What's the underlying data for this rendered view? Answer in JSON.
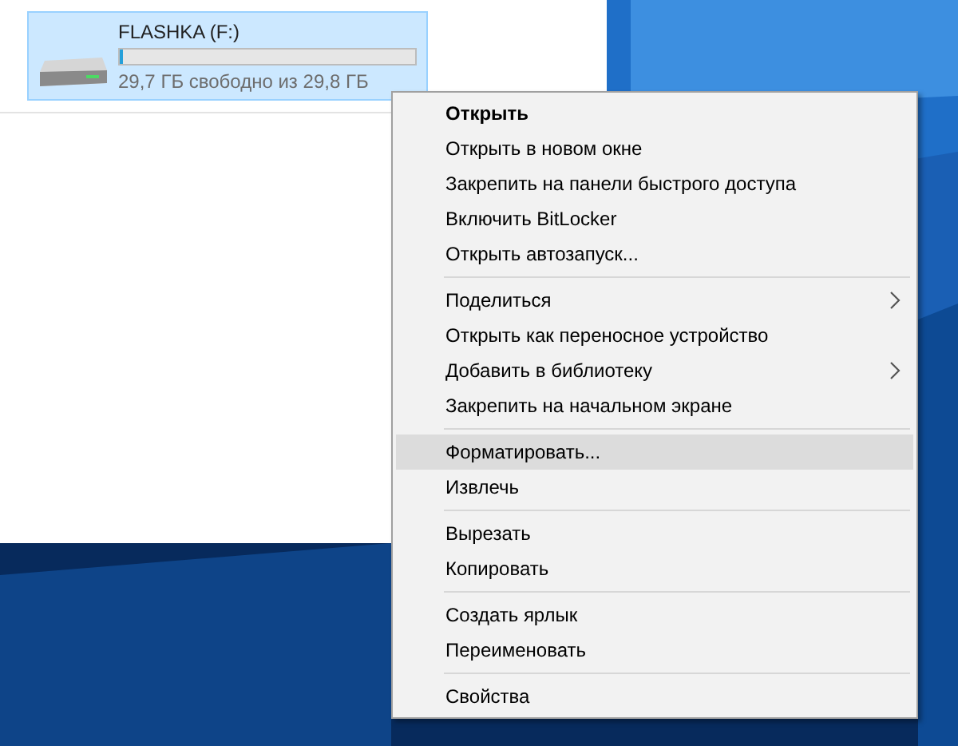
{
  "drive": {
    "name": "FLASHKA (F:)",
    "free_space": "29,7 ГБ свободно из 29,8 ГБ",
    "level": 0.01,
    "selected": true
  },
  "context_menu": {
    "groups": [
      {
        "items": [
          {
            "label": "Открыть",
            "default": true,
            "submenu": false,
            "selected": false
          },
          {
            "label": "Открыть в новом окне",
            "default": false,
            "submenu": false,
            "selected": false
          },
          {
            "label": "Закрепить на панели быстрого доступа",
            "default": false,
            "submenu": false,
            "selected": false
          },
          {
            "label": "Включить BitLocker",
            "default": false,
            "submenu": false,
            "selected": false
          },
          {
            "label": "Открыть автозапуск...",
            "default": false,
            "submenu": false,
            "selected": false
          }
        ]
      },
      {
        "items": [
          {
            "label": "Поделиться",
            "default": false,
            "submenu": true,
            "selected": false
          },
          {
            "label": "Открыть как переносное устройство",
            "default": false,
            "submenu": false,
            "selected": false
          },
          {
            "label": "Добавить в библиотеку",
            "default": false,
            "submenu": true,
            "selected": false
          },
          {
            "label": "Закрепить на начальном экране",
            "default": false,
            "submenu": false,
            "selected": false
          }
        ]
      },
      {
        "items": [
          {
            "label": "Форматировать...",
            "default": false,
            "submenu": false,
            "selected": true
          },
          {
            "label": "Извлечь",
            "default": false,
            "submenu": false,
            "selected": false
          }
        ]
      },
      {
        "items": [
          {
            "label": "Вырезать",
            "default": false,
            "submenu": false,
            "selected": false
          },
          {
            "label": "Копировать",
            "default": false,
            "submenu": false,
            "selected": false
          }
        ]
      },
      {
        "items": [
          {
            "label": "Создать ярлык",
            "default": false,
            "submenu": false,
            "selected": false
          },
          {
            "label": "Переименовать",
            "default": false,
            "submenu": false,
            "selected": false
          }
        ]
      },
      {
        "items": [
          {
            "label": "Свойства",
            "default": false,
            "submenu": false,
            "selected": false
          }
        ]
      }
    ]
  }
}
